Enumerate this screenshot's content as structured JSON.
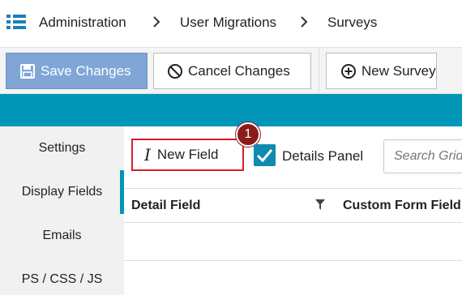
{
  "breadcrumb": {
    "items": [
      "Administration",
      "User Migrations",
      "Surveys"
    ]
  },
  "toolbar": {
    "save_label": "Save Changes",
    "cancel_label": "Cancel Changes",
    "new_survey_label": "New Survey"
  },
  "sidebar": {
    "items": [
      {
        "label": "Settings"
      },
      {
        "label": "Display Fields"
      },
      {
        "label": "Emails"
      },
      {
        "label": "PS / CSS / JS"
      }
    ]
  },
  "content": {
    "new_field_label": "New Field",
    "step_badge": "1",
    "details_panel_label": "Details Panel",
    "details_panel_checked": true,
    "search_placeholder": "Search Grid"
  },
  "table": {
    "columns": [
      "Detail Field",
      "Custom Form Field"
    ]
  },
  "colors": {
    "accent": "#0096b7",
    "save_button": "#7fa6d6",
    "highlight": "#d71f26",
    "badge": "#8a1c1c"
  }
}
